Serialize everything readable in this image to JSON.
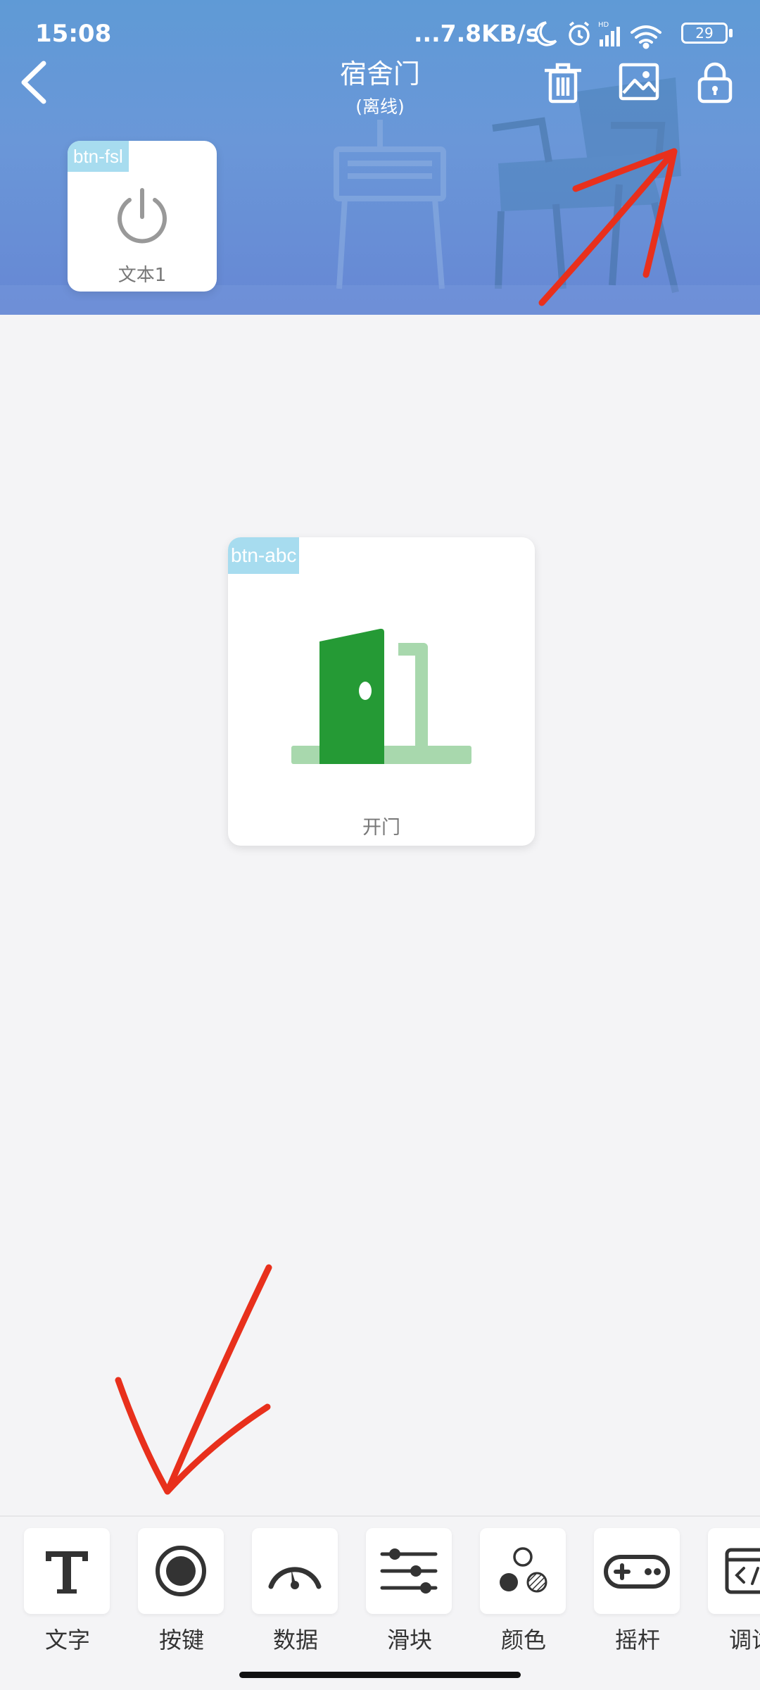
{
  "status_bar": {
    "time": "15:08",
    "network": "...7.8KB/s",
    "battery": "29",
    "icons": [
      "moon-icon",
      "alarm-icon",
      "signal-icon",
      "wifi-icon",
      "battery-icon"
    ]
  },
  "nav": {
    "title": "宿舍门",
    "subtitle": "(离线)",
    "icons": [
      "back-icon",
      "trash-icon",
      "image-icon",
      "lock-icon"
    ]
  },
  "widgets": [
    {
      "tag": "btn-fsl",
      "label": "文本1",
      "icon": "power-icon"
    },
    {
      "tag": "btn-abc",
      "label": "开门",
      "icon": "door-icon"
    }
  ],
  "toolbar": {
    "items": [
      {
        "label": "文字",
        "icon": "text-icon"
      },
      {
        "label": "按键",
        "icon": "button-icon"
      },
      {
        "label": "数据",
        "icon": "gauge-icon"
      },
      {
        "label": "滑块",
        "icon": "slider-icon"
      },
      {
        "label": "颜色",
        "icon": "color-icon"
      },
      {
        "label": "摇杆",
        "icon": "gamepad-icon"
      },
      {
        "label": "调试",
        "icon": "debug-icon"
      }
    ]
  },
  "colors": {
    "header": "#6a97d8",
    "tag": "#a7dcef",
    "door_green": "#259a35",
    "door_light": "#a8d8ad",
    "annotation": "#e8301c"
  }
}
